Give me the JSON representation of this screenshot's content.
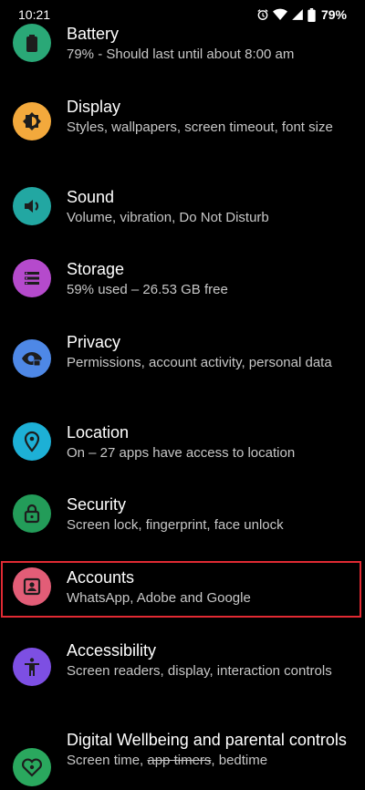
{
  "status": {
    "time": "10:21",
    "battery": "79%",
    "icons": [
      "alarm-icon",
      "wifi-icon",
      "signal-icon",
      "battery-icon"
    ]
  },
  "settings": [
    {
      "title": "Battery",
      "subtitle": "79% - Should last until about 8:00 am",
      "icon": "battery-icon",
      "color": "#2aa877"
    },
    {
      "title": "Display",
      "subtitle": "Styles, wallpapers, screen timeout, font size",
      "icon": "brightness-icon",
      "color": "#f3a93c"
    },
    {
      "title": "Sound",
      "subtitle": "Volume, vibration, Do Not Disturb",
      "icon": "volume-icon",
      "color": "#22a7a2"
    },
    {
      "title": "Storage",
      "subtitle": "59% used – 26.53 GB free",
      "icon": "storage-icon",
      "color": "#b54acc"
    },
    {
      "title": "Privacy",
      "subtitle": "Permissions, account activity, personal data",
      "icon": "eye-lock-icon",
      "color": "#4e88e6"
    },
    {
      "title": "Location",
      "subtitle": "On – 27 apps have access to location",
      "icon": "location-pin-icon",
      "color": "#1db0d6"
    },
    {
      "title": "Security",
      "subtitle": "Screen lock, fingerprint, face unlock",
      "icon": "lock-icon",
      "color": "#239c59"
    },
    {
      "title": "Accounts",
      "subtitle": "WhatsApp, Adobe and Google",
      "icon": "account-box-icon",
      "color": "#e25d77"
    },
    {
      "title": "Accessibility",
      "subtitle": "Screen readers, display, interaction controls",
      "icon": "accessibility-icon",
      "color": "#7d4fe3"
    },
    {
      "title": "Digital Wellbeing and parental controls",
      "subtitle_prefix": "Screen time, ",
      "subtitle_strike": "app timers",
      "subtitle_suffix": ", bedtime",
      "icon": "wellbeing-heart-icon",
      "color": "#2aa85e"
    }
  ],
  "highlight_color": "#e12a33"
}
